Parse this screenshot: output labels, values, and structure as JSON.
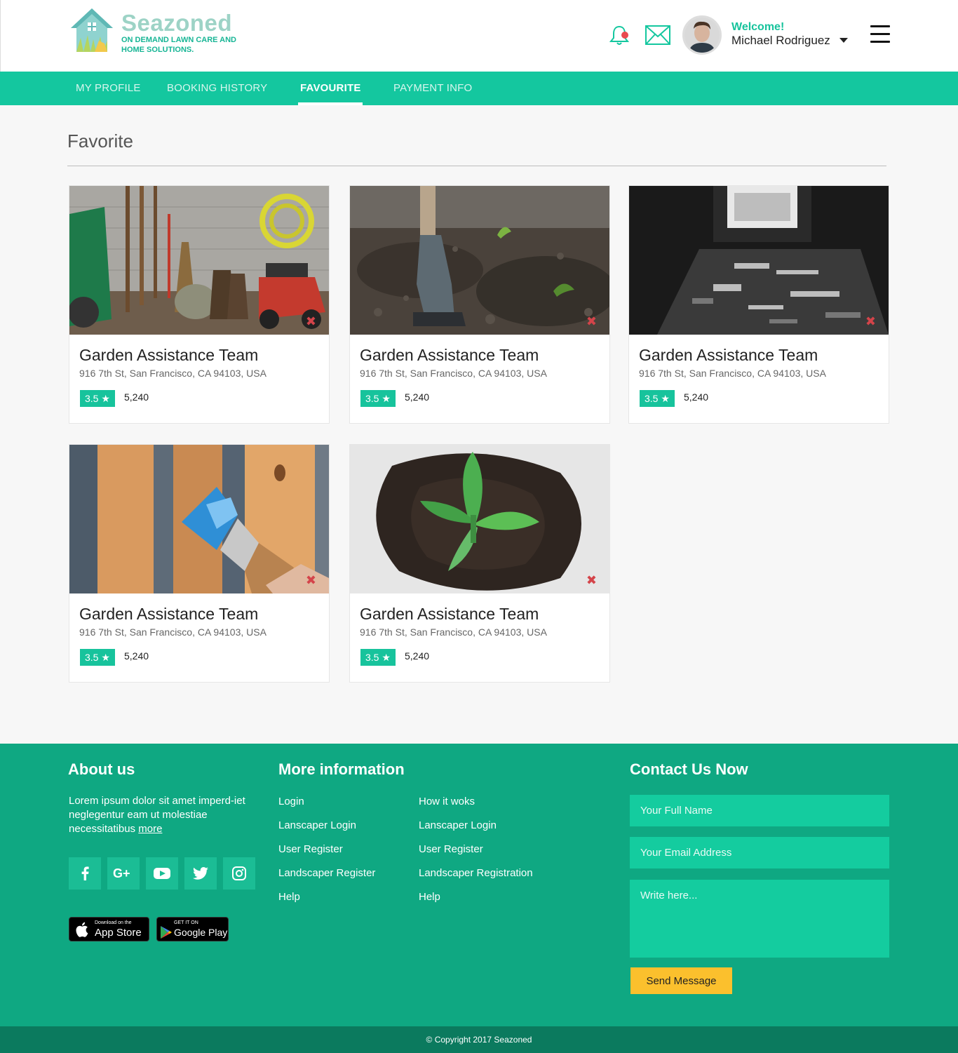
{
  "header": {
    "logo_title": "Seazoned",
    "logo_tagline": "ON DEMAND LAWN CARE AND HOME SOLUTIONS.",
    "welcome": "Welcome!",
    "username": "Michael Rodriguez"
  },
  "nav": {
    "items": [
      {
        "label": "MY PROFILE"
      },
      {
        "label": "BOOKING HISTORY"
      },
      {
        "label": "FAVOURITE"
      },
      {
        "label": "PAYMENT INFO"
      }
    ],
    "active": "FAVOURITE"
  },
  "main": {
    "title": "Favorite",
    "cards": [
      {
        "image": "garden-tools-photo",
        "title": "Garden Assistance Team",
        "address": "916 7th St, San Francisco, CA 94103, USA",
        "rating": "3.5",
        "count": "5,240"
      },
      {
        "image": "shovel-soil-photo",
        "title": "Garden Assistance Team",
        "address": "916 7th St, San Francisco, CA 94103, USA",
        "rating": "3.5",
        "count": "5,240"
      },
      {
        "image": "workbench-tools-photo",
        "title": "Garden Assistance Team",
        "address": "916 7th St, San Francisco, CA 94103, USA",
        "rating": "3.5",
        "count": "5,240"
      },
      {
        "image": "painting-wood-photo",
        "title": "Garden Assistance Team",
        "address": "916 7th St, San Francisco, CA 94103, USA",
        "rating": "3.5",
        "count": "5,240"
      },
      {
        "image": "seedling-photo",
        "title": "Garden Assistance Team",
        "address": "916 7th St, San Francisco, CA 94103, USA",
        "rating": "3.5",
        "count": "5,240"
      }
    ]
  },
  "footer": {
    "about": {
      "heading": "About us",
      "text": "Lorem ipsum dolor sit amet imperd-iet neglegentur eam ut molestiae necessitatibus",
      "more": "more"
    },
    "more_info": {
      "heading": "More information",
      "col1": [
        "Login",
        "Lanscaper Login",
        "User Register",
        "Landscaper Register",
        "Help"
      ],
      "col2": [
        "How it woks",
        "Lanscaper Login",
        "User Register",
        "Landscaper Registration",
        "Help"
      ]
    },
    "contact": {
      "heading": "Contact Us Now",
      "name_placeholder": "Your Full Name",
      "email_placeholder": "Your Email Address",
      "message_placeholder": "Write here...",
      "send": "Send Message"
    },
    "social": [
      "facebook-icon",
      "google-plus-icon",
      "youtube-icon",
      "twitter-icon",
      "instagram-icon"
    ],
    "app_store": {
      "small": "Download on the",
      "big": "App Store"
    },
    "google_play": {
      "small": "GET IT ON",
      "big": "Google Play"
    },
    "copyright": "© Copyright 2017 Seazoned"
  },
  "colors": {
    "accent": "#14c79f",
    "footer": "#0fa882",
    "footer_bottom": "#0b7a5e",
    "send_button": "#fbc02d",
    "remove": "#d4444a"
  }
}
